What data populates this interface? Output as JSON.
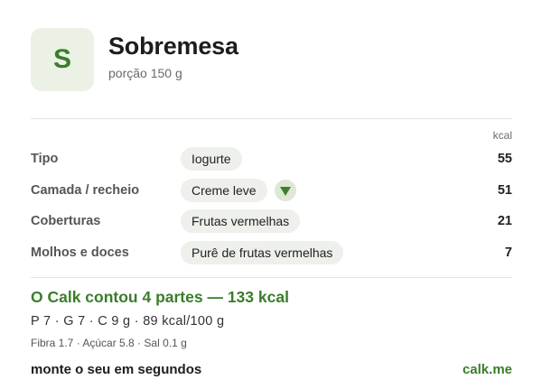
{
  "header": {
    "avatar_letter": "S",
    "title": "Sobremesa",
    "subtitle": "porção 150 g"
  },
  "table": {
    "unit_header": "kcal",
    "rows": [
      {
        "label": "Tipo",
        "value": "Iogurte",
        "kcal": "55",
        "has_dropdown": false
      },
      {
        "label": "Camada / recheio",
        "value": "Creme leve",
        "kcal": "51",
        "has_dropdown": true,
        "dropdown_icon": "triangle-down-icon"
      },
      {
        "label": "Coberturas",
        "value": "Frutas vermelhas",
        "kcal": "21",
        "has_dropdown": false
      },
      {
        "label": "Molhos e doces",
        "value": "Purê de frutas vermelhas",
        "kcal": "7",
        "has_dropdown": false
      }
    ]
  },
  "summary": {
    "headline": "O Calk contou 4 partes — 133 kcal",
    "macros": "P 7 · G 7 · C 9 g   ·   89 kcal/100 g",
    "micros": "Fibra 1.7 · Açúcar 5.8 · Sal 0.1 g"
  },
  "footer": {
    "cta": "monte o seu em segundos",
    "brand": "calk.me"
  },
  "colors": {
    "accent": "#3a7d2a",
    "avatar_bg": "#ecf1e6",
    "chip_bg": "#eef0ec"
  }
}
